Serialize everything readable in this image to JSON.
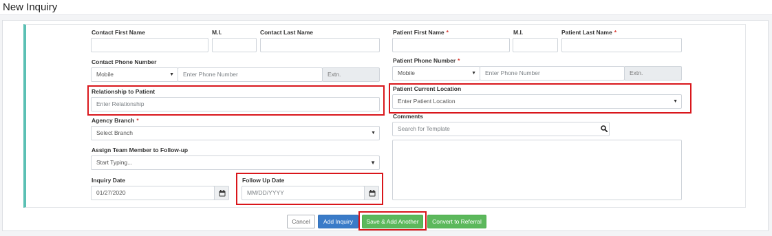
{
  "page": {
    "title": "New Inquiry"
  },
  "contact": {
    "first_name_label": "Contact First Name",
    "mi_label": "M.I.",
    "last_name_label": "Contact Last Name",
    "phone_label": "Contact Phone Number",
    "phone_type": "Mobile",
    "phone_placeholder": "Enter Phone Number",
    "ext_placeholder": "Extn."
  },
  "relationship": {
    "label": "Relationship to Patient",
    "placeholder": "Enter Relationship"
  },
  "agency_branch": {
    "label": "Agency Branch",
    "required_mark": "*",
    "value": "Select Branch"
  },
  "team_member": {
    "label": "Assign Team Member to Follow-up",
    "value": "Start Typing..."
  },
  "inquiry_date": {
    "label": "Inquiry Date",
    "value": "01/27/2020"
  },
  "follow_up_date": {
    "label": "Follow Up Date",
    "placeholder": "MM/DD/YYYY"
  },
  "patient": {
    "first_name_label": "Patient First Name",
    "mi_label": "M.I.",
    "last_name_label": "Patient Last Name",
    "required_mark": "*",
    "phone_label": "Patient Phone Number",
    "phone_type": "Mobile",
    "phone_placeholder": "Enter Phone Number",
    "ext_placeholder": "Extn.",
    "location_label": "Patient Current Location",
    "location_value": "Enter Patient Location"
  },
  "comments": {
    "label": "Comments",
    "template_placeholder": "Search for Template"
  },
  "actions": {
    "cancel": "Cancel",
    "add_inquiry": "Add Inquiry",
    "save_add_another": "Save & Add Another",
    "convert_to_referral": "Convert to Referral"
  },
  "colors": {
    "accent_bar": "#5bc0b4",
    "highlight_box": "#d9161b",
    "primary_button": "#3a7bc8",
    "success_button": "#5cb85c",
    "required_mark": "#d9342b"
  },
  "icons": {
    "select_caret": "caret-down-icon",
    "calendar": "calendar-icon",
    "search": "search-icon"
  }
}
